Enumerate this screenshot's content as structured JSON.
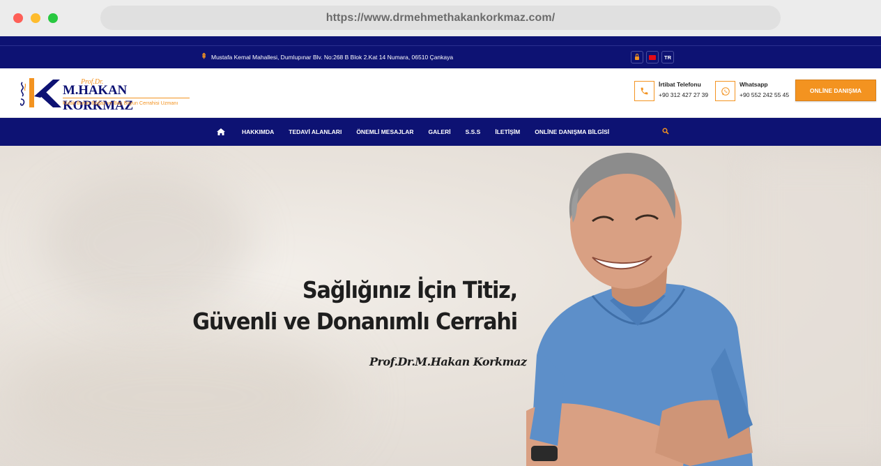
{
  "browser": {
    "url": "https://www.drmehmethakankorkmaz.com/"
  },
  "topbar": {
    "address": "Mustafa Kemal Mahallesi, Dumlupınar Blv. No:268 B Blok 2.Kat 14 Numara, 06510 Çankaya",
    "language": "TR"
  },
  "logo": {
    "prefix": "Prof.Dr.",
    "name": "M.HAKAN KORKMAZ",
    "subtitle": "Kulak Burun Boğaz ve Baş Boyun Cerrahisi Uzmanı"
  },
  "contacts": {
    "phone_title": "İrtibat Telefonu",
    "phone_value": "+90 312 427 27 39",
    "whatsapp_title": "Whatsapp",
    "whatsapp_value": "+90 552 242 55 45"
  },
  "cta": {
    "label": "ONLİNE DANIŞMA"
  },
  "nav": {
    "items": [
      "HAKKIMDA",
      "TEDAVİ ALANLARI",
      "ÖNEMLİ MESAJLAR",
      "GALERİ",
      "S.S.S",
      "İLETİŞİM",
      "ONLİNE DANIŞMA BİLGİSİ"
    ]
  },
  "hero": {
    "line1": "Sağlığınız İçin Titiz,",
    "line2": "Güvenli ve Donanımlı Cerrahi",
    "signature": "Prof.Dr.M.Hakan Korkmaz"
  },
  "colors": {
    "navy": "#0d1273",
    "orange": "#f39320"
  }
}
